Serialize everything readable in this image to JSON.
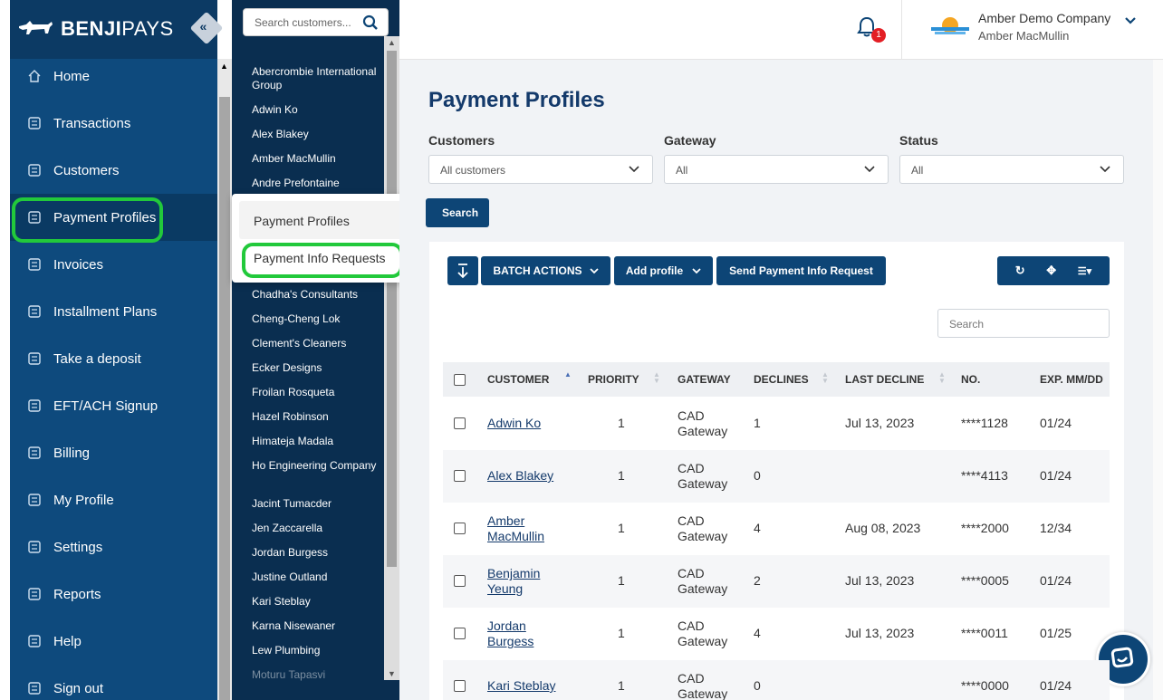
{
  "brand": {
    "name_bold": "BENJI",
    "name_thin": "PAYS"
  },
  "nav": {
    "items": [
      {
        "label": "Home",
        "icon": "home-icon"
      },
      {
        "label": "Transactions",
        "icon": "transactions-icon"
      },
      {
        "label": "Customers",
        "icon": "customers-icon"
      },
      {
        "label": "Payment Profiles",
        "icon": "payment-profiles-icon",
        "active": true
      },
      {
        "label": "Invoices",
        "icon": "invoices-icon"
      },
      {
        "label": "Installment Plans",
        "icon": "calendar-icon"
      },
      {
        "label": "Take a deposit",
        "icon": "deposit-icon"
      },
      {
        "label": "EFT/ACH Signup",
        "icon": "bank-icon"
      },
      {
        "label": "Billing",
        "icon": "billing-icon"
      },
      {
        "label": "My Profile",
        "icon": "profile-icon"
      },
      {
        "label": "Settings",
        "icon": "gear-icon"
      },
      {
        "label": "Reports",
        "icon": "reports-icon"
      },
      {
        "label": "Help",
        "icon": "info-icon"
      },
      {
        "label": "Sign out",
        "icon": "sign-out-icon"
      }
    ]
  },
  "customer_panel": {
    "search_placeholder": "Search customers...",
    "customers": [
      "Abercrombie International Group",
      "Adwin Ko",
      "Alex Blakey",
      "Amber MacMullin",
      "Andre Prefontaine",
      "Chadha's Consultants",
      "Cheng-Cheng Lok",
      "Clement's Cleaners",
      "Ecker Designs",
      "Froilan Rosqueta",
      "Hazel Robinson",
      "Himateja Madala",
      "Ho Engineering Company",
      "Jacint Tumacder",
      "Jen Zaccarella",
      "Jordan Burgess",
      "Justine Outland",
      "Kari Steblay",
      "Karna Nisewaner",
      "Lew Plumbing",
      "Moturu Tapasvi"
    ]
  },
  "popup_menu": {
    "item1": "Payment Profiles",
    "item2": "Payment Info Requests"
  },
  "header": {
    "notification_count": "1",
    "company": "Amber Demo Company",
    "user": "Amber MacMullin"
  },
  "page": {
    "title": "Payment Profiles",
    "filters": {
      "customers_label": "Customers",
      "customers_value": "All customers",
      "gateway_label": "Gateway",
      "gateway_value": "All",
      "status_label": "Status",
      "status_value": "All"
    },
    "search_button": "Search",
    "toolbar": {
      "batch_actions": "BATCH ACTIONS",
      "add_profile": "Add profile",
      "send_request": "Send Payment Info Request"
    },
    "table_search_placeholder": "Search",
    "columns": [
      "CUSTOMER",
      "PRIORITY",
      "GATEWAY",
      "DECLINES",
      "LAST DECLINE",
      "NO.",
      "EXP. MM/DD"
    ],
    "rows": [
      {
        "customer": "Adwin Ko",
        "priority": "1",
        "gateway": "CAD Gateway",
        "declines": "1",
        "last_decline": "Jul 13, 2023",
        "no": "****1128",
        "exp": "01/24"
      },
      {
        "customer": "Alex Blakey",
        "priority": "1",
        "gateway": "CAD Gateway",
        "declines": "0",
        "last_decline": "",
        "no": "****4113",
        "exp": "01/24"
      },
      {
        "customer": "Amber MacMullin",
        "priority": "1",
        "gateway": "CAD Gateway",
        "declines": "4",
        "last_decline": "Aug 08, 2023",
        "no": "****2000",
        "exp": "12/34"
      },
      {
        "customer": "Benjamin Yeung",
        "priority": "1",
        "gateway": "CAD Gateway",
        "declines": "2",
        "last_decline": "Jul 13, 2023",
        "no": "****0005",
        "exp": "01/24"
      },
      {
        "customer": "Jordan Burgess",
        "priority": "1",
        "gateway": "CAD Gateway",
        "declines": "4",
        "last_decline": "Jul 13, 2023",
        "no": "****0011",
        "exp": "01/25"
      },
      {
        "customer": "Kari Steblay",
        "priority": "1",
        "gateway": "CAD Gateway",
        "declines": "0",
        "last_decline": "",
        "no": "****0000",
        "exp": "01/24"
      }
    ]
  },
  "colors": {
    "primary": "#0d4576",
    "nav_bg": "#0e4a7d",
    "highlight": "#22c93b",
    "badge": "#e31e24"
  }
}
